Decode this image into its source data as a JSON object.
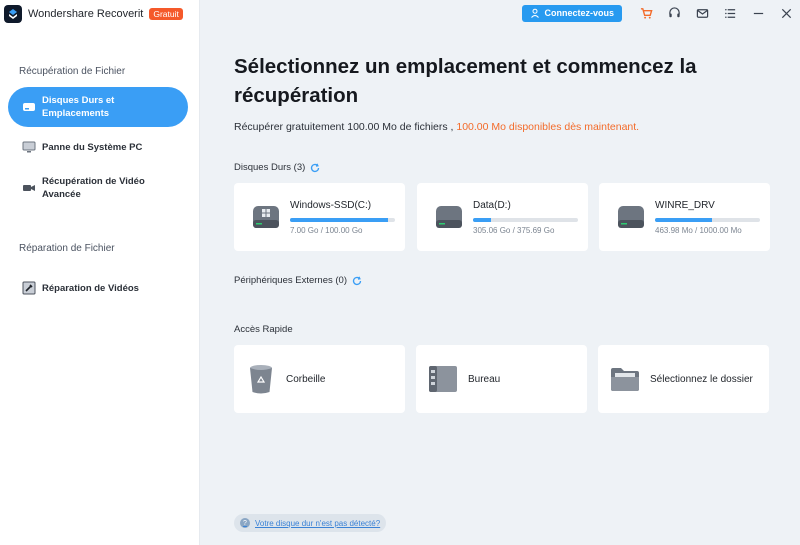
{
  "app": {
    "name": "Wondershare Recoverit",
    "badge": "Gratuit"
  },
  "topbar": {
    "connect_label": "Connectez-vous",
    "icons": [
      "cart-icon",
      "headset-icon",
      "mail-icon",
      "menu-list-icon",
      "minimize-icon",
      "close-icon"
    ]
  },
  "sidebar": {
    "section1_title": "Récupération de Fichier",
    "items": [
      {
        "line1": "Disques Durs et",
        "line2": "Emplacements",
        "icon": "hard-drive-icon",
        "active": true
      },
      {
        "line1": "Panne du Système PC",
        "line2": "",
        "icon": "monitor-icon",
        "active": false
      },
      {
        "line1": "Récupération de Vidéo",
        "line2": "Avancée",
        "icon": "video-camera-icon",
        "active": false
      }
    ],
    "section2_title": "Réparation de Fichier",
    "repair_items": [
      {
        "label": "Réparation de Vidéos",
        "icon": "video-repair-icon"
      }
    ]
  },
  "main": {
    "heading": "Sélectionnez un emplacement et commencez la récupération",
    "subline_prefix": "Récupérer gratuitement 100.00 Mo de fichiers ,",
    "subline_accent": "100.00 Mo disponibles dès maintenant.",
    "drives_title": "Disques Durs (3)",
    "drives": [
      {
        "name": "Windows-SSD(C:)",
        "usage": "7.00 Go / 100.00 Go",
        "fill": 0.93,
        "icon": "windows-drive-icon"
      },
      {
        "name": "Data(D:)",
        "usage": "305.06 Go / 375.69 Go",
        "fill": 0.17,
        "icon": "drive-icon"
      },
      {
        "name": "WINRE_DRV",
        "usage": "463.98 Mo / 1000.00 Mo",
        "fill": 0.54,
        "icon": "drive-icon"
      }
    ],
    "external_title": "Périphériques Externes (0)",
    "quick_title": "Accès Rapide",
    "quick": [
      {
        "label": "Corbeille",
        "icon": "recycle-bin-icon"
      },
      {
        "label": "Bureau",
        "icon": "desktop-icon"
      },
      {
        "label": "Sélectionnez le dossier",
        "icon": "folder-icon"
      }
    ],
    "help_link": "Votre disque dur n'est pas détecté?"
  },
  "colors": {
    "accent": "#3a9ef5",
    "orange": "#f36b2a",
    "badge": "#f5592a"
  }
}
